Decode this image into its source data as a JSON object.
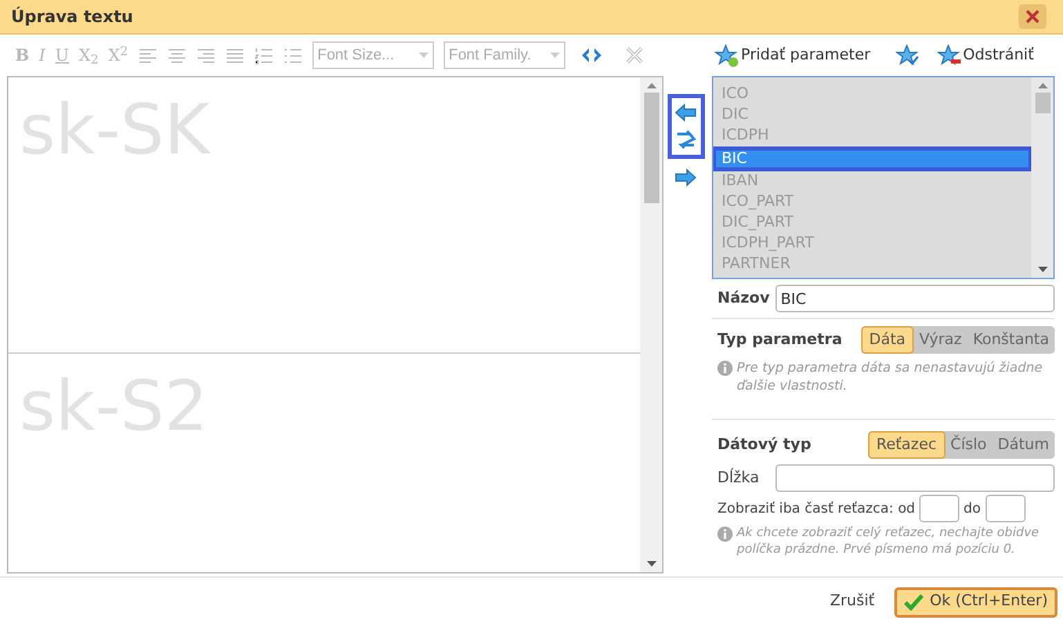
{
  "window": {
    "title": "Úprava textu"
  },
  "toolbar": {
    "format_buttons": [
      {
        "label": "B",
        "kind": "bold"
      },
      {
        "label": "I",
        "kind": "italic"
      },
      {
        "label": "U",
        "kind": "underline"
      },
      {
        "label": "X$_{2}$",
        "kind": "plain"
      },
      {
        "label": "X$^{2}$",
        "kind": "plain"
      }
    ],
    "selects": [
      {
        "placeholder": "Font Size..."
      },
      {
        "placeholder": "Font Family."
      }
    ]
  },
  "editor": {
    "panes": [
      {
        "text": "sk-SK"
      },
      {
        "text": "sk-S2"
      }
    ]
  },
  "params_toolbar": {
    "add": "Pridať parameter",
    "remove": "Odstrániť"
  },
  "params": [
    {
      "label": "ICO",
      "selected": false
    },
    {
      "label": "DIC",
      "selected": false
    },
    {
      "label": "ICDPH",
      "selected": false
    },
    {
      "label": "BIC",
      "selected": true
    },
    {
      "label": "IBAN",
      "selected": false
    },
    {
      "label": "ICO_PART",
      "selected": false
    },
    {
      "label": "DIC_PART",
      "selected": false
    },
    {
      "label": "ICDPH_PART",
      "selected": false
    },
    {
      "label": "PARTNER",
      "selected": false
    }
  ],
  "name_field": {
    "label": "Názov",
    "value": "BIC"
  },
  "param_type": {
    "label": "Typ parametra",
    "options": [
      {
        "label": "Dáta",
        "selected": true
      },
      {
        "label": "Výraz",
        "selected": false
      },
      {
        "label": "Konštanta",
        "selected": false
      }
    ],
    "note": "Pre typ parametra dáta sa nenastavujú žiadne ďalšie vlastnosti."
  },
  "data_type": {
    "label": "Dátový typ",
    "options": [
      {
        "label": "Reťazec",
        "selected": true
      },
      {
        "label": "Číslo",
        "selected": false
      },
      {
        "label": "Dátum",
        "selected": false
      }
    ]
  },
  "length_field": {
    "label": "Dĺžka"
  },
  "substring": {
    "label": "Zobraziť iba časť reťazca: od",
    "to_label": "do",
    "note": "Ak chcete zobraziť celý reťazec, nechajte obidve políčka prázdne. Prvé písmeno má pozíciu 0."
  },
  "footer": {
    "cancel": "Zrušiť",
    "ok": "Ok (Ctrl+Enter)"
  }
}
